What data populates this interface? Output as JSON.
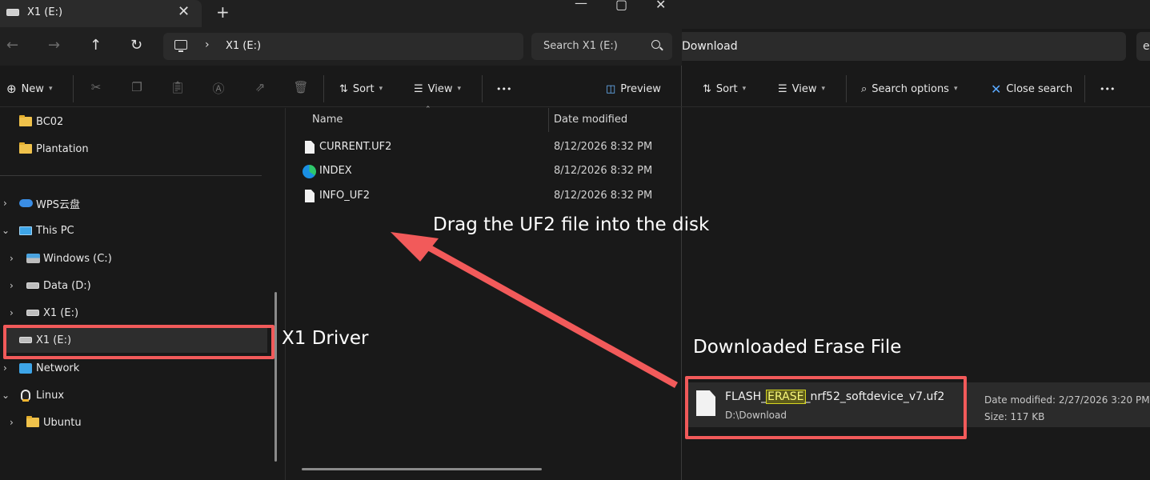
{
  "left_window": {
    "tab_title": "X1 (E:)",
    "tab_close_glyph": "✕",
    "new_tab_glyph": "+",
    "address_path": "X1 (E:)",
    "search_placeholder": "Search X1 (E:)",
    "toolbar": {
      "new_label": "New",
      "sort_label": "Sort",
      "view_label": "View",
      "more_glyph": "•••",
      "preview_label": "Preview"
    },
    "nav_items": {
      "bc02": "BC02",
      "plantation": "Plantation",
      "wps": "WPS云盘",
      "this_pc": "This PC",
      "windows_c": "Windows (C:)",
      "data_d": "Data (D:)",
      "x1_e_child": "X1 (E:)",
      "x1_e_selected": "X1 (E:)",
      "network": "Network",
      "linux": "Linux",
      "ubuntu": "Ubuntu"
    },
    "columns": {
      "name": "Name",
      "date": "Date modified"
    },
    "files": [
      {
        "name": "CURRENT.UF2",
        "date": "8/12/2026 8:32 PM"
      },
      {
        "name": "INDEX",
        "date": "8/12/2026 8:32 PM"
      },
      {
        "name": "INFO_UF2",
        "date": "8/12/2026 8:32 PM"
      }
    ]
  },
  "right_window": {
    "address_path": "Download",
    "search_partial": "e",
    "toolbar": {
      "sort_label": "Sort",
      "view_label": "View",
      "search_options_label": "Search options",
      "close_search_label": "Close search",
      "more_glyph": "•••"
    },
    "result": {
      "name_prefix": "FLASH_",
      "name_highlight": "ERASE",
      "name_suffix": "_nrf52_softdevice_v7.uf2",
      "path": "D:\\Download",
      "date_modified": "Date modified: 2/27/2026 3:20 PM",
      "size": "Size: 117 KB"
    }
  },
  "annotations": {
    "drag_text": "Drag the UF2 file into the disk",
    "driver_text": "X1 Driver",
    "erase_text": "Downloaded Erase File"
  },
  "colors": {
    "annotation_red": "#f25a5a",
    "highlight": "#f8f87a",
    "background": "#191919"
  }
}
